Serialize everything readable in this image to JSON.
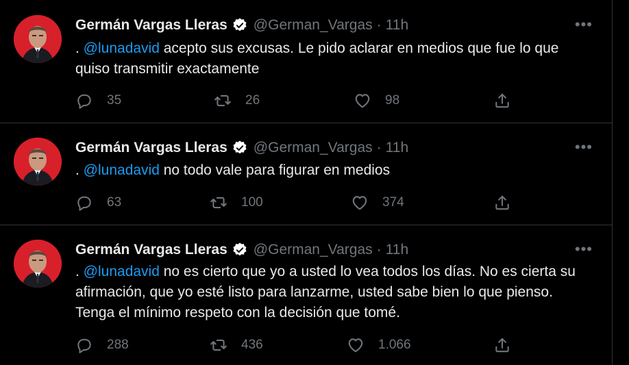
{
  "colors": {
    "background": "#000000",
    "text": "#e7e9ea",
    "muted": "#71767b",
    "mention": "#1d9bf0",
    "verified": "#ffffff",
    "avatar_bg": "#d8202b"
  },
  "tweets": [
    {
      "name": "Germán Vargas Lleras",
      "handle": "@German_Vargas",
      "separator": "·",
      "time": "11h",
      "more": "•••",
      "prefix": ". ",
      "mention": "@lunadavid",
      "text": " acepto sus excusas. Le pido aclarar en medios que fue lo que quiso transmitir exactamente",
      "replies": "35",
      "retweets": "26",
      "likes": "98"
    },
    {
      "name": "Germán Vargas Lleras",
      "handle": "@German_Vargas",
      "separator": "·",
      "time": "11h",
      "more": "•••",
      "prefix": ". ",
      "mention": "@lunadavid",
      "text": " no todo vale para figurar en medios",
      "replies": "63",
      "retweets": "100",
      "likes": "374"
    },
    {
      "name": "Germán Vargas Lleras",
      "handle": "@German_Vargas",
      "separator": "·",
      "time": "11h",
      "more": "•••",
      "prefix": ". ",
      "mention": "@lunadavid",
      "text": " no es cierto que yo a usted lo vea todos los días. No es cierta su afirmación, que yo esté listo para lanzarme, usted sabe bien lo que pienso. Tenga el mínimo respeto con la decisión que tomé.",
      "replies": "288",
      "retweets": "436",
      "likes": "1.066"
    }
  ]
}
